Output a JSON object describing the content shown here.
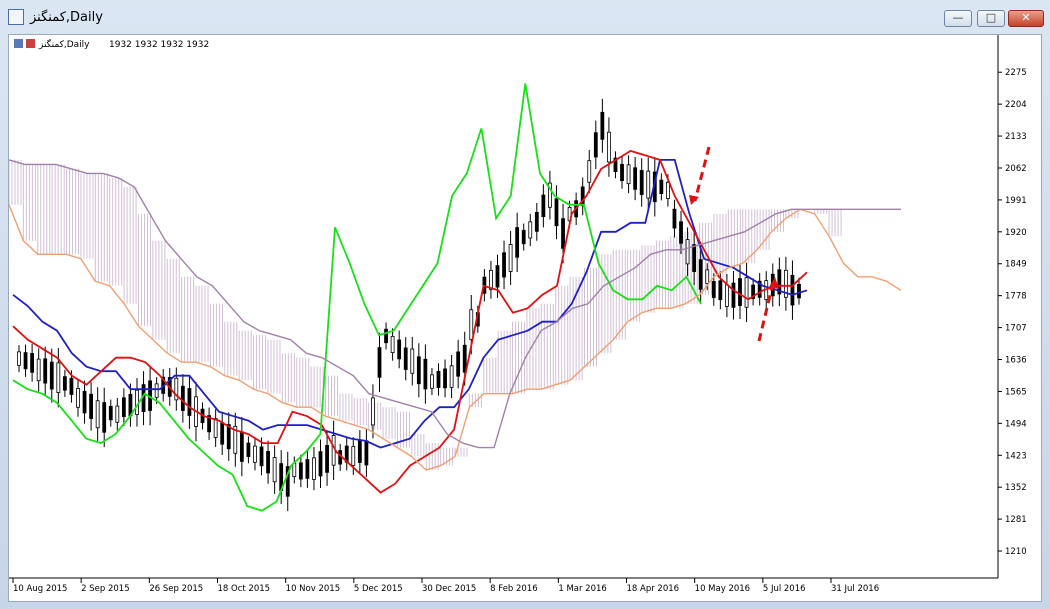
{
  "window": {
    "title": "کمنگنز,Daily",
    "minimize_symbol": "—",
    "maximize_symbol": "□",
    "close_symbol": "✕"
  },
  "chart_header": {
    "symbol": "کمنگنز,Daily",
    "ohlc": "1932 1932 1932 1932"
  },
  "chart_data": {
    "type": "line",
    "title": "کمنگنز,Daily",
    "ylim": [
      1150,
      2340
    ],
    "y_ticks": [
      2275,
      2204,
      2133,
      2062,
      1991,
      1920,
      1849,
      1778,
      1707,
      1636,
      1565,
      1494,
      1423,
      1352,
      1281,
      1210
    ],
    "x_tick_labels": [
      "10 Aug 2015",
      "2 Sep 2015",
      "26 Sep 2015",
      "18 Oct 2015",
      "10 Nov 2015",
      "5 Dec 2015",
      "30 Dec 2015",
      "8 Feb 2016",
      "1 Mar 2016",
      "18 Apr 2016",
      "10 May 2016",
      "5 Jul 2016",
      "31 Jul 2016"
    ],
    "grid": false,
    "series": [
      {
        "color": "#1f1fc8",
        "values": [
          1780,
          1755,
          1720,
          1700,
          1650,
          1620,
          1610,
          1610,
          1570,
          1570,
          1570,
          1600,
          1600,
          1560,
          1520,
          1510,
          1500,
          1480,
          1490,
          1490,
          1490,
          1480,
          1470,
          1460,
          1455,
          1440,
          1450,
          1460,
          1500,
          1530,
          1530,
          1570,
          1640,
          1680,
          1690,
          1700,
          1720,
          1720,
          1760,
          1830,
          1920,
          1920,
          1940,
          1940,
          2080,
          2080,
          1960,
          1860,
          1850,
          1840,
          1820,
          1800,
          1790,
          1780,
          1790
        ]
      },
      {
        "color": "#e01010",
        "values": [
          1710,
          1680,
          1660,
          1640,
          1600,
          1580,
          1610,
          1640,
          1640,
          1630,
          1600,
          1560,
          1530,
          1510,
          1500,
          1480,
          1470,
          1450,
          1450,
          1520,
          1510,
          1490,
          1430,
          1400,
          1370,
          1340,
          1360,
          1400,
          1420,
          1440,
          1480,
          1640,
          1800,
          1790,
          1740,
          1750,
          1780,
          1800,
          1960,
          2000,
          2060,
          2080,
          2100,
          2090,
          2080,
          2000,
          1940,
          1880,
          1820,
          1790,
          1770,
          1790,
          1800,
          1800,
          1830
        ]
      },
      {
        "color": "#18e018",
        "values": [
          1590,
          1570,
          1560,
          1540,
          1500,
          1460,
          1450,
          1470,
          1510,
          1560,
          1540,
          1500,
          1460,
          1430,
          1400,
          1380,
          1310,
          1300,
          1320,
          1400,
          1430,
          1470,
          1930,
          1850,
          1760,
          1690,
          1700,
          1750,
          1800,
          1850,
          2000,
          2050,
          2150,
          1950,
          2000,
          2250,
          2050,
          2000,
          1980,
          1980,
          1850,
          1790,
          1770,
          1770,
          1800,
          1790,
          1820,
          1760
        ]
      },
      {
        "color": "#f0a070",
        "values": [
          1980,
          1900,
          1870,
          1870,
          1870,
          1860,
          1810,
          1800,
          1760,
          1710,
          1680,
          1650,
          1630,
          1630,
          1620,
          1600,
          1590,
          1570,
          1560,
          1540,
          1530,
          1530,
          1510,
          1500,
          1490,
          1480,
          1460,
          1440,
          1420,
          1390,
          1400,
          1420,
          1530,
          1560,
          1560,
          1560,
          1570,
          1570,
          1580,
          1590,
          1620,
          1650,
          1680,
          1720,
          1740,
          1750,
          1750,
          1760,
          1780,
          1820,
          1840,
          1850,
          1880,
          1920,
          1950,
          1970,
          1960,
          1910,
          1850,
          1820,
          1820,
          1810,
          1790
        ]
      },
      {
        "color": "#a080a8",
        "values": [
          2080,
          2070,
          2070,
          2070,
          2060,
          2050,
          2050,
          2040,
          2020,
          1960,
          1900,
          1860,
          1820,
          1800,
          1760,
          1720,
          1700,
          1690,
          1680,
          1650,
          1640,
          1620,
          1600,
          1560,
          1550,
          1540,
          1530,
          1520,
          1470,
          1450,
          1440,
          1440,
          1560,
          1640,
          1700,
          1720,
          1750,
          1760,
          1800,
          1820,
          1840,
          1870,
          1880,
          1880,
          1890,
          1900,
          1910,
          1920,
          1940,
          1960,
          1970,
          1970,
          1970,
          1970,
          1970,
          1970,
          1970,
          1970
        ]
      }
    ]
  }
}
